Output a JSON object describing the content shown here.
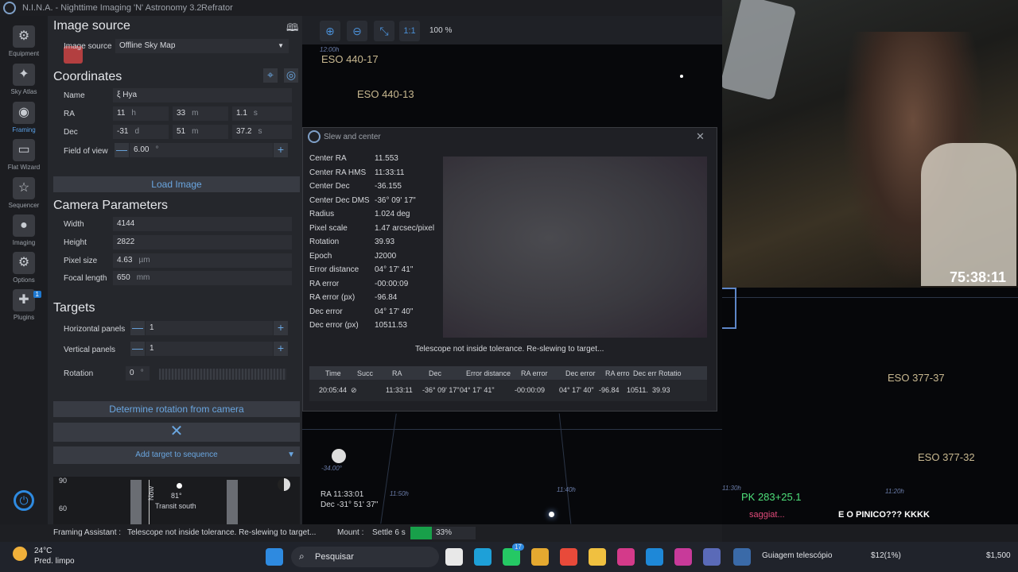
{
  "window": {
    "app_title": "N.I.N.A. - Nighttime Imaging 'N' Astronomy 3.2",
    "profile": "Refrator"
  },
  "nav": [
    {
      "label": "Equipment",
      "icon": "equipment-icon",
      "glyph": "⚙"
    },
    {
      "label": "Sky Atlas",
      "icon": "sky-atlas-icon",
      "glyph": "✦"
    },
    {
      "label": "Framing",
      "icon": "framing-icon",
      "glyph": "◉"
    },
    {
      "label": "Flat Wizard",
      "icon": "flat-wizard-icon",
      "glyph": "▭"
    },
    {
      "label": "Sequencer",
      "icon": "sequencer-icon",
      "glyph": "☆"
    },
    {
      "label": "Imaging",
      "icon": "imaging-icon",
      "glyph": "●"
    },
    {
      "label": "Options",
      "icon": "options-icon",
      "glyph": "⚙"
    },
    {
      "label": "Plugins",
      "icon": "plugins-icon",
      "glyph": "✚",
      "badge": "1"
    }
  ],
  "image_source": {
    "heading": "Image source",
    "label": "Image source",
    "value": "Offline Sky Map"
  },
  "coordinates": {
    "heading": "Coordinates",
    "name_label": "Name",
    "name_value": "ξ Hya",
    "ra_label": "RA",
    "ra_h": "11",
    "ra_h_unit": "h",
    "ra_m": "33",
    "ra_m_unit": "m",
    "ra_s": "1.1",
    "ra_s_unit": "s",
    "dec_label": "Dec",
    "dec_d": "-31",
    "dec_d_unit": "d",
    "dec_m": "51",
    "dec_m_unit": "m",
    "dec_s": "37.2",
    "dec_s_unit": "s",
    "fov_label": "Field of view",
    "fov_value": "6.00",
    "fov_unit": "°"
  },
  "load_image": "Load Image",
  "camera": {
    "heading": "Camera Parameters",
    "width_label": "Width",
    "width_value": "4144",
    "height_label": "Height",
    "height_value": "2822",
    "pixel_label": "Pixel size",
    "pixel_value": "4.63",
    "pixel_unit": "µm",
    "focal_label": "Focal length",
    "focal_value": "650",
    "focal_unit": "mm"
  },
  "targets": {
    "heading": "Targets",
    "hpanels_label": "Horizontal panels",
    "hpanels_value": "1",
    "vpanels_label": "Vertical panels",
    "vpanels_value": "1",
    "rotation_label": "Rotation",
    "rotation_value": "0",
    "rotation_unit": "°"
  },
  "determine_rotation": "Determine rotation from camera",
  "add_target": "Add target to sequence",
  "altitude_chart": {
    "y_ticks": [
      "90",
      "60"
    ],
    "now_label": "Now",
    "alt_value": "81°",
    "transit_label": "Transit south"
  },
  "sky_toolbar": {
    "zoom": "100 %",
    "one_to_one": "1:1"
  },
  "sky_labels": [
    {
      "text": "ESO 440-17"
    },
    {
      "text": "ESO 440-13"
    },
    {
      "text": "ESO 377-37"
    },
    {
      "text": "ESO 377-32"
    },
    {
      "text": "PK 283+25.1"
    }
  ],
  "sky_coords": [
    "12:00h",
    "11:50h",
    "11:40h",
    "11:30h",
    "11:20h",
    "-34.00°"
  ],
  "cursor_readout": {
    "ra": "RA  11:33:01",
    "dec": "Dec  -31° 51' 37\""
  },
  "dialog": {
    "title": "Slew and center",
    "rows": [
      {
        "label": "Center RA",
        "value": "11.553"
      },
      {
        "label": "Center RA HMS",
        "value": "11:33:11"
      },
      {
        "label": "Center Dec",
        "value": "-36.155"
      },
      {
        "label": "Center Dec DMS",
        "value": "-36° 09' 17\""
      },
      {
        "label": "Radius",
        "value": "1.024 deg"
      },
      {
        "label": "Pixel scale",
        "value": "1.47 arcsec/pixel"
      },
      {
        "label": "Rotation",
        "value": "39.93"
      },
      {
        "label": "Epoch",
        "value": "J2000"
      },
      {
        "label": "Error distance",
        "value": "04° 17' 41\""
      },
      {
        "label": "RA error",
        "value": "-00:00:09"
      },
      {
        "label": "RA error (px)",
        "value": "-96.84"
      },
      {
        "label": "Dec error",
        "value": "04° 17' 40\""
      },
      {
        "label": "Dec error (px)",
        "value": "10511.53"
      }
    ],
    "message": "Telescope not inside tolerance. Re-slewing to target...",
    "table_headers": [
      "Time",
      "Succ",
      "RA",
      "Dec",
      "Error distance",
      "RA error",
      "Dec error",
      "RA erro",
      "Dec err",
      "Rotatio"
    ],
    "table_row": [
      "20:05:44",
      "⊘",
      "11:33:11",
      "-36° 09' 17\"",
      "04° 17' 41\"",
      "-00:00:09",
      "04° 17' 40\"",
      "-96.84",
      "10511.",
      "39.93"
    ]
  },
  "stream": {
    "timer": "75:38:11",
    "chat_user": "saggiat...",
    "chat_msg": "E O PINICO??? KKKK"
  },
  "status_bar": {
    "framing_label": "Framing Assistant :",
    "framing_msg": "Telescope not inside tolerance. Re-slewing to target...",
    "mount_label": "Mount :",
    "mount_msg": "Settle 6 s",
    "progress": 0.33,
    "progress_label": "33%"
  },
  "taskbar": {
    "weather_temp": "24°C",
    "weather_desc": "Pred. limpo",
    "search_placeholder": "Pesquisar",
    "whatsapp_badge": "17",
    "active_window": "Guiagem telescópio",
    "balance": "$12(1%)",
    "balance2": "$1,500"
  },
  "colors": {
    "accent": "#2e8ae0",
    "progress_fill": "#18a04a",
    "panel": "#25272c"
  }
}
